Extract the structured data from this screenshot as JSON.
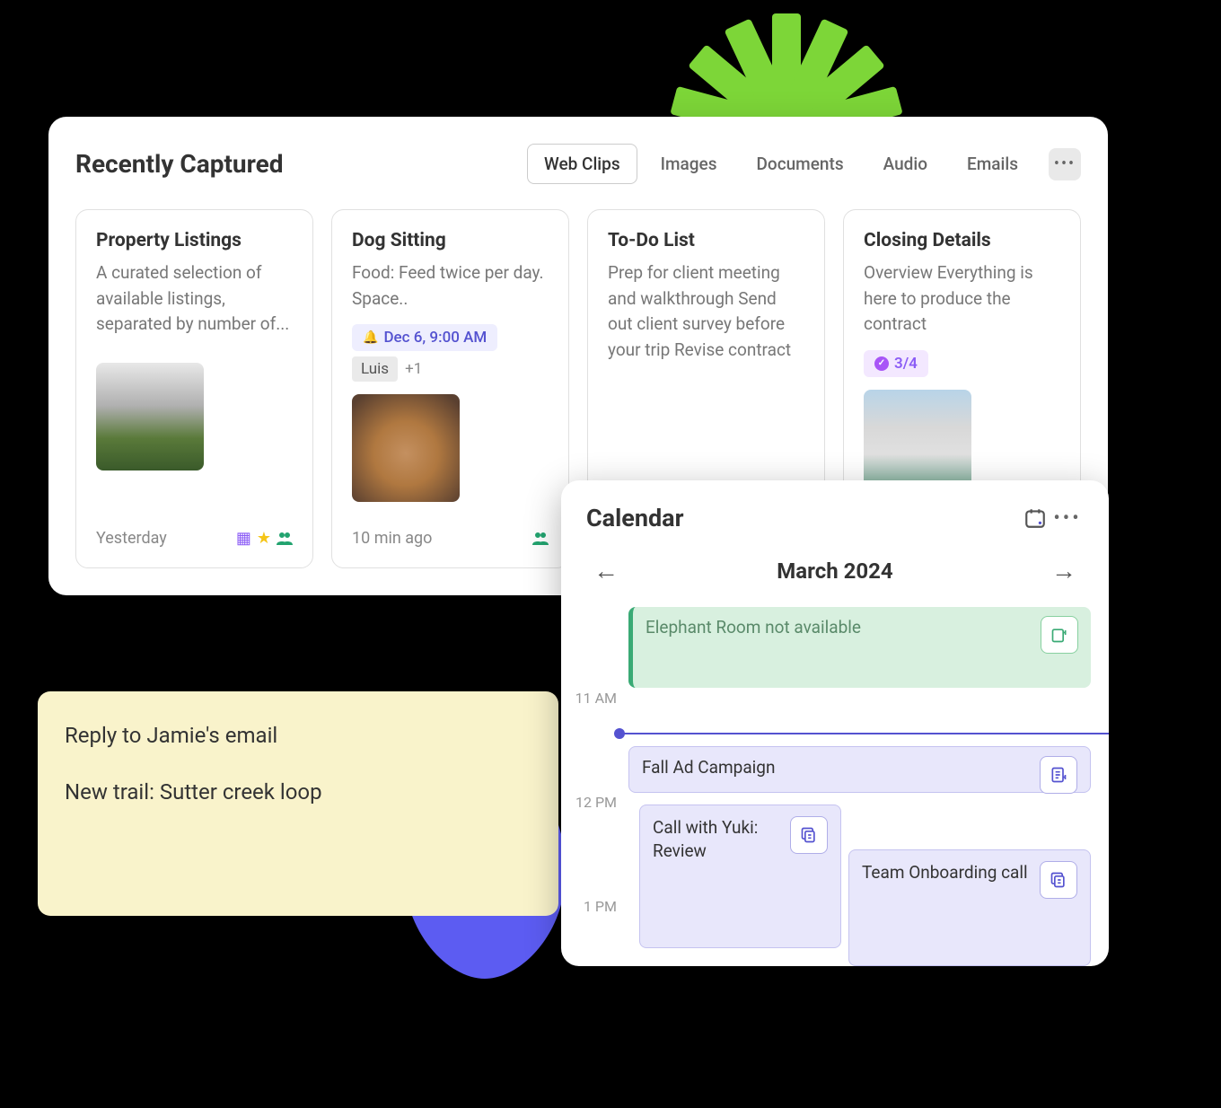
{
  "recently": {
    "title": "Recently Captured",
    "tabs": [
      "Web Clips",
      "Images",
      "Documents",
      "Audio",
      "Emails"
    ],
    "cards": [
      {
        "title": "Property Listings",
        "body": "A curated selection of available listings, separated by number of...",
        "time": "Yesterday"
      },
      {
        "title": "Dog Sitting",
        "body": "Food: Feed twice per day. Space..",
        "reminder": "Dec 6, 9:00 AM",
        "person": "Luis",
        "personExtra": "+1",
        "time": "10 min ago"
      },
      {
        "title": "To-Do List",
        "body": "Prep for client meeting and walkthrough Send out client survey before your trip Revise contract"
      },
      {
        "title": "Closing Details",
        "body": "Overview Everything is here to produce the contract",
        "progress": "3/4"
      }
    ]
  },
  "sticky": {
    "line1": "Reply to Jamie's email",
    "line2": "New trail: Sutter creek loop"
  },
  "calendar": {
    "title": "Calendar",
    "month": "March 2024",
    "times": {
      "t11": "11 AM",
      "t12": "12 PM",
      "t1": "1 PM"
    },
    "events": {
      "green": "Elephant Room not available",
      "p1": "Fall Ad Campaign",
      "p2": "Call with Yuki: Review",
      "p3": "Team Onboarding call"
    }
  }
}
